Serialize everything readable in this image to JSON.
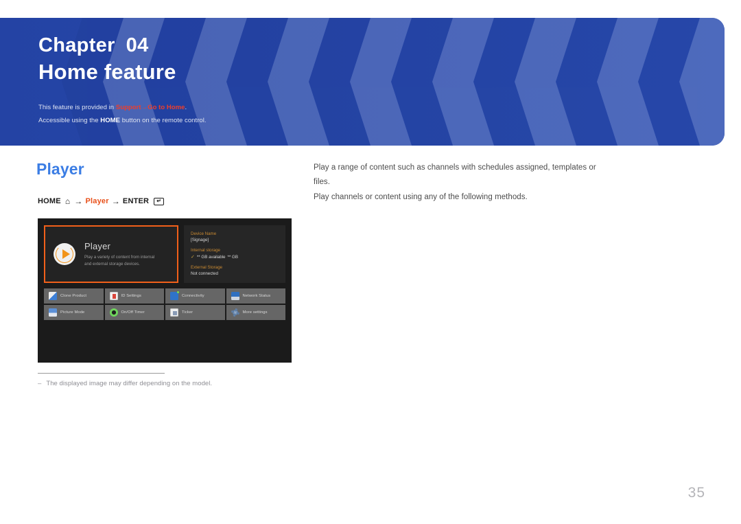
{
  "banner": {
    "chapter_label": "Chapter",
    "chapter_number": "04",
    "title": "Home feature",
    "note1_prefix": "This feature is provided in ",
    "note1_link1": "Support",
    "note1_arrow": "→",
    "note1_link2": "Go to Home",
    "note1_suffix": ".",
    "note2_prefix": "Accessible using the ",
    "note2_bold": "HOME",
    "note2_suffix": " button on the remote control.",
    "bg_color": "#2443a4",
    "accent_color": "#ef3e2a"
  },
  "section": {
    "title": "Player",
    "title_color": "#3b7de4"
  },
  "nav_path": {
    "home_label": "HOME",
    "home_icon": "home-icon",
    "arrow1": "→",
    "target_label": "Player",
    "arrow2": "→",
    "enter_label": "ENTER",
    "enter_icon": "enter-key-icon",
    "enter_glyph": "↵",
    "accent_color": "#e8501a"
  },
  "body": {
    "lines": [
      "Play a range of content such as channels with schedules assigned, templates or files.",
      "Play channels or content using any of the following methods."
    ]
  },
  "screenshot": {
    "player_card": {
      "title": "Player",
      "description_line1": "Play a variety of content from internal",
      "description_line2": "and external storage devices.",
      "icon": "play-circle-icon",
      "border_color": "#f2601a"
    },
    "info_panel": {
      "device_name_label": "Device Name",
      "device_name_value": "[Signage]",
      "internal_storage_label": "Internal storage",
      "internal_storage_check": "✓",
      "internal_storage_value": "** GB available",
      "internal_storage_total": "** GB",
      "external_storage_label": "External Storage",
      "external_storage_value": "Not connected",
      "label_color": "#c98a32"
    },
    "tiles": [
      {
        "label": "Clone Product",
        "icon": "clone-product-icon"
      },
      {
        "label": "ID Settings",
        "icon": "id-settings-icon"
      },
      {
        "label": "Connectivity",
        "icon": "connectivity-icon"
      },
      {
        "label": "Network Status",
        "icon": "network-status-icon"
      },
      {
        "label": "Picture Mode",
        "icon": "picture-mode-icon"
      },
      {
        "label": "On/Off Timer",
        "icon": "on-off-timer-icon"
      },
      {
        "label": "Ticker",
        "icon": "ticker-icon"
      },
      {
        "label": "More settings",
        "icon": "gear-icon"
      }
    ]
  },
  "footnote": {
    "dash": "‒",
    "text": "The displayed image may differ depending on the model."
  },
  "page_number": "35"
}
